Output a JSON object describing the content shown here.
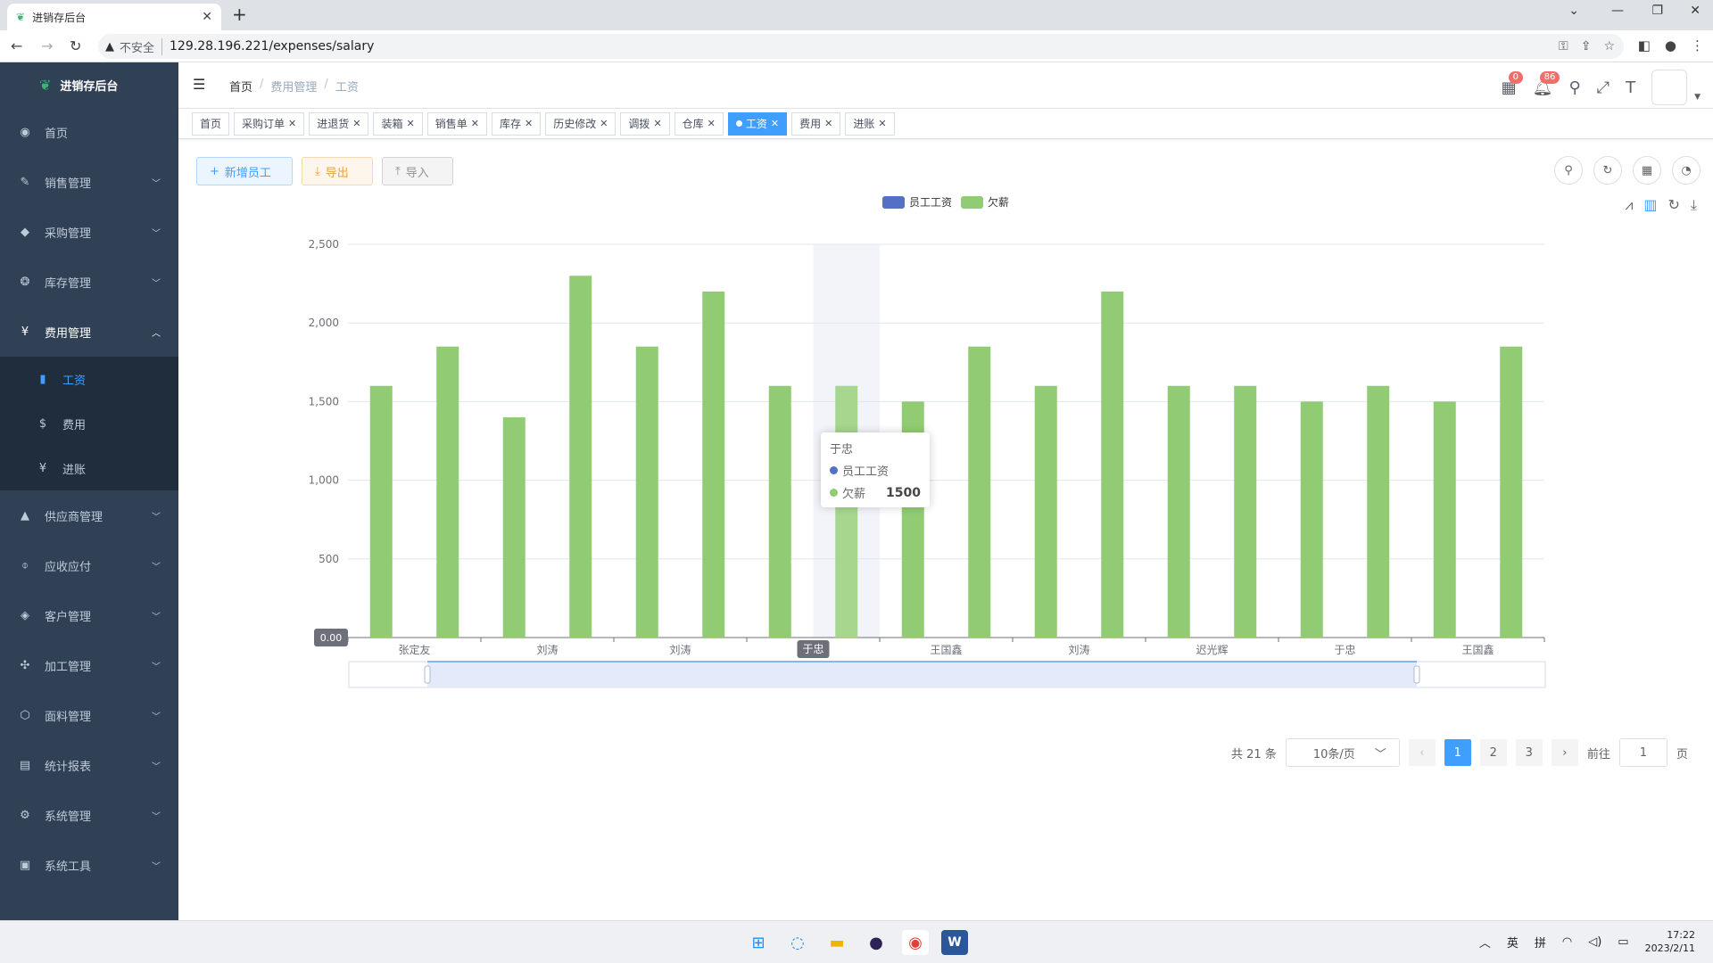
{
  "browser": {
    "tab_title": "进销存后台",
    "insecure_label": "不安全",
    "url": "129.28.196.221/expenses/salary"
  },
  "sidebar": {
    "logo": "进销存后台",
    "items": [
      {
        "label": "首页",
        "icon": "dashboard-icon"
      },
      {
        "label": "销售管理",
        "icon": "sales-icon"
      },
      {
        "label": "采购管理",
        "icon": "purchase-icon"
      },
      {
        "label": "库存管理",
        "icon": "inventory-icon"
      },
      {
        "label": "费用管理",
        "icon": "yen-icon"
      },
      {
        "label": "供应商管理",
        "icon": "supplier-icon"
      },
      {
        "label": "应收应付",
        "icon": "finance-icon"
      },
      {
        "label": "客户管理",
        "icon": "customer-icon"
      },
      {
        "label": "加工管理",
        "icon": "process-icon"
      },
      {
        "label": "面料管理",
        "icon": "fabric-icon"
      },
      {
        "label": "统计报表",
        "icon": "report-icon"
      },
      {
        "label": "系统管理",
        "icon": "gear-icon"
      },
      {
        "label": "系统工具",
        "icon": "toolbox-icon"
      }
    ],
    "sub_items": [
      {
        "label": "工资",
        "icon": "bookmark-icon"
      },
      {
        "label": "费用",
        "icon": "dollar-icon"
      },
      {
        "label": "进账",
        "icon": "yen-icon"
      }
    ]
  },
  "header": {
    "breadcrumb": [
      "首页",
      "费用管理",
      "工资"
    ],
    "badge_msg": "0",
    "badge_bell": "86"
  },
  "tags": [
    "首页",
    "采购订单",
    "进退货",
    "装箱",
    "销售单",
    "库存",
    "历史修改",
    "调拨",
    "仓库",
    "工资",
    "费用",
    "进账"
  ],
  "active_tag": "工资",
  "toolbar": {
    "add_label": "新增员工",
    "export_label": "导出",
    "import_label": "导入"
  },
  "colors": {
    "salary": "#5470c6",
    "arrears": "#91cc75",
    "accent": "#409eff"
  },
  "chart_data": {
    "type": "bar",
    "legend": [
      "员工工资",
      "欠薪"
    ],
    "ylim": [
      0,
      2500
    ],
    "yticks": [
      "0.00",
      "500",
      "1,000",
      "1,500",
      "2,000",
      "2,500"
    ],
    "x_labels": [
      "张定友",
      "刘涛",
      "刘涛",
      "于忠",
      "王国鑫",
      "刘涛",
      "迟光辉",
      "于忠",
      "王国鑫"
    ],
    "series": [
      {
        "name": "欠薪",
        "values": [
          1600,
          1850,
          1400,
          2300,
          1850,
          2200,
          1600,
          1600,
          1500,
          1850,
          1600,
          2200,
          1600,
          1600,
          1500,
          1600,
          1500,
          1850
        ]
      }
    ],
    "highlight_index": 7,
    "highlight_label": "于忠"
  },
  "tooltip": {
    "name": "于忠",
    "series1": "员工工资",
    "series2": "欠薪",
    "value": "1500"
  },
  "pagination": {
    "total": "共 21 条",
    "size": "10条/页",
    "pages": [
      "1",
      "2",
      "3"
    ],
    "goto": "前往",
    "goto_value": "1",
    "page_suffix": "页"
  },
  "taskbar": {
    "lang1": "英",
    "lang2": "拼",
    "time": "17:22",
    "date": "2023/2/11"
  }
}
